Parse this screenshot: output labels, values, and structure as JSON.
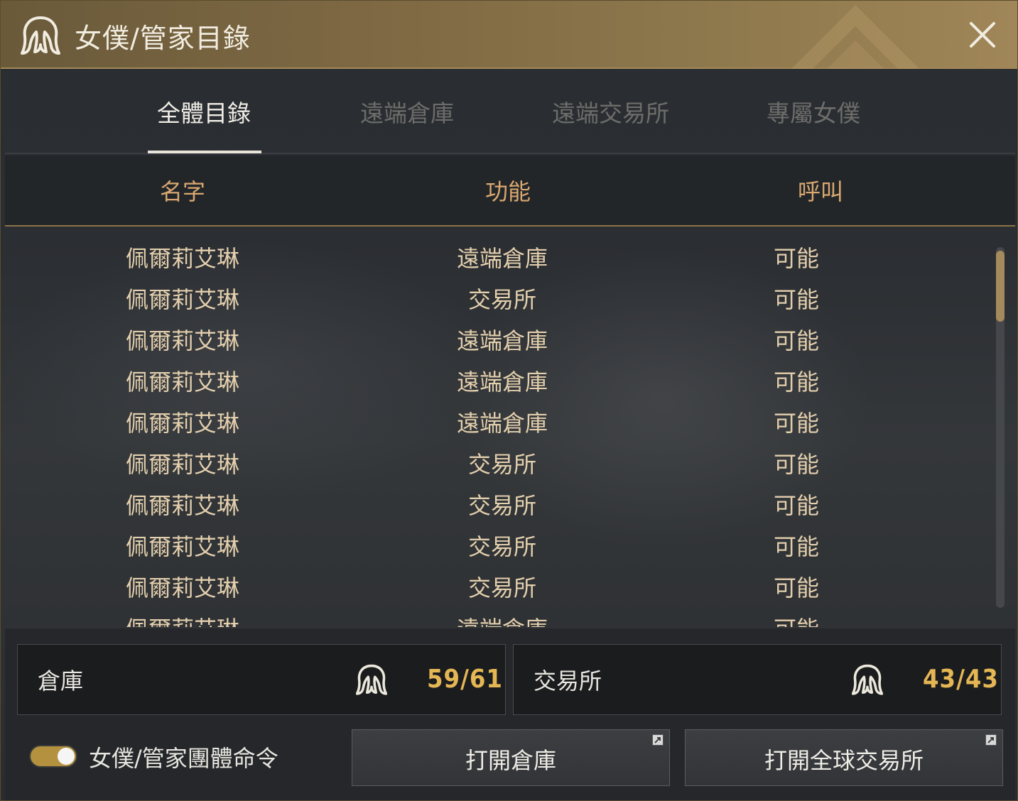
{
  "window": {
    "title": "女僕/管家目錄",
    "close_icon": "close-icon"
  },
  "tabs": [
    {
      "label": "全體目錄",
      "active": true
    },
    {
      "label": "遠端倉庫",
      "active": false
    },
    {
      "label": "遠端交易所",
      "active": false
    },
    {
      "label": "專屬女僕",
      "active": false
    }
  ],
  "columns": {
    "name": "名字",
    "function": "功能",
    "call": "呼叫"
  },
  "rows": [
    {
      "name": "佩爾莉艾琳",
      "function": "遠端倉庫",
      "call": "可能"
    },
    {
      "name": "佩爾莉艾琳",
      "function": "交易所",
      "call": "可能"
    },
    {
      "name": "佩爾莉艾琳",
      "function": "遠端倉庫",
      "call": "可能"
    },
    {
      "name": "佩爾莉艾琳",
      "function": "遠端倉庫",
      "call": "可能"
    },
    {
      "name": "佩爾莉艾琳",
      "function": "遠端倉庫",
      "call": "可能"
    },
    {
      "name": "佩爾莉艾琳",
      "function": "交易所",
      "call": "可能"
    },
    {
      "name": "佩爾莉艾琳",
      "function": "交易所",
      "call": "可能"
    },
    {
      "name": "佩爾莉艾琳",
      "function": "交易所",
      "call": "可能"
    },
    {
      "name": "佩爾莉艾琳",
      "function": "交易所",
      "call": "可能"
    },
    {
      "name": "佩爾莉艾琳",
      "function": "遠端倉庫",
      "call": "可能"
    }
  ],
  "stats": {
    "warehouse": {
      "label": "倉庫",
      "value": "59/61",
      "icon": "maid-icon"
    },
    "market": {
      "label": "交易所",
      "value": "43/43",
      "icon": "maid-icon"
    }
  },
  "group_command": {
    "label": "女僕/管家團體命令",
    "enabled": true
  },
  "buttons": {
    "open_warehouse": "打開倉庫",
    "open_market": "打開全球交易所"
  },
  "colors": {
    "accent_gold": "#e4b654",
    "header_text": "#d9a870",
    "row_text": "#e3cfad",
    "titlebar": "#8a7448"
  }
}
